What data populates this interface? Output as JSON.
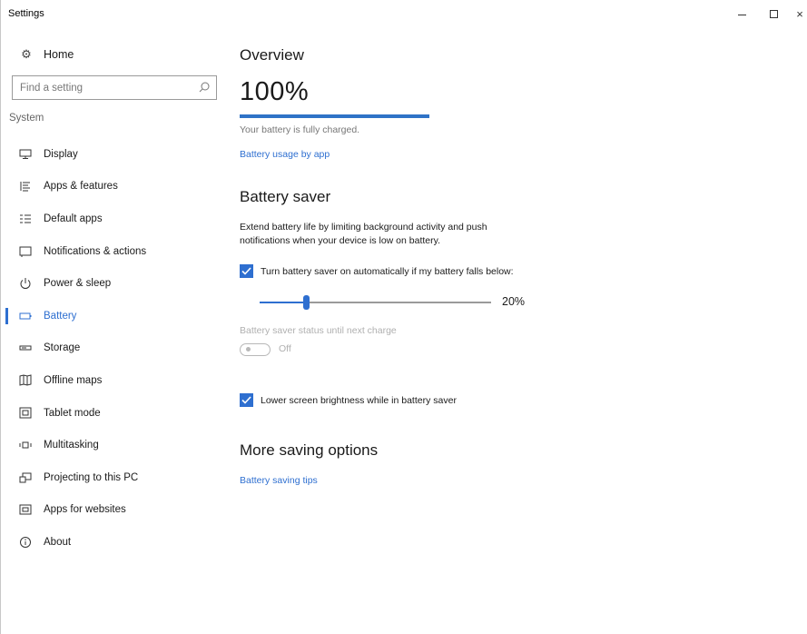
{
  "window": {
    "title": "Settings",
    "controls": {
      "minimize": "–",
      "maximize": "□",
      "close": "×"
    }
  },
  "sidebar": {
    "home_label": "Home",
    "home_icon": "gear-icon",
    "search_placeholder": "Find a setting",
    "section_label": "System",
    "items": [
      {
        "label": "Display",
        "icon": "monitor-icon",
        "active": false
      },
      {
        "label": "Apps & features",
        "icon": "list-icon",
        "active": false
      },
      {
        "label": "Default apps",
        "icon": "default-apps-icon",
        "active": false
      },
      {
        "label": "Notifications & actions",
        "icon": "notification-icon",
        "active": false
      },
      {
        "label": "Power & sleep",
        "icon": "power-icon",
        "active": false
      },
      {
        "label": "Battery",
        "icon": "battery-icon",
        "active": true
      },
      {
        "label": "Storage",
        "icon": "storage-icon",
        "active": false
      },
      {
        "label": "Offline maps",
        "icon": "map-icon",
        "active": false
      },
      {
        "label": "Tablet mode",
        "icon": "tablet-icon",
        "active": false
      },
      {
        "label": "Multitasking",
        "icon": "multitasking-icon",
        "active": false
      },
      {
        "label": "Projecting to this PC",
        "icon": "projecting-icon",
        "active": false
      },
      {
        "label": "Apps for websites",
        "icon": "web-apps-icon",
        "active": false
      },
      {
        "label": "About",
        "icon": "info-icon",
        "active": false
      }
    ]
  },
  "overview": {
    "heading": "Overview",
    "percent": "100%",
    "progress_fraction": 1.0,
    "status": "Your battery is fully charged.",
    "usage_link": "Battery usage by app"
  },
  "battery_saver": {
    "heading": "Battery saver",
    "description": "Extend battery life by limiting background activity and push notifications when your device is low on battery.",
    "auto_checkbox_label": "Turn battery saver on automatically if my battery falls below:",
    "auto_checked": true,
    "threshold_fraction": 0.2,
    "threshold_label": "20%",
    "status_label": "Battery saver status until next charge",
    "status_toggle": "Off",
    "brightness_checkbox_label": "Lower screen brightness while in battery saver",
    "brightness_checked": true
  },
  "more_saving": {
    "heading": "More saving options",
    "tips_link": "Battery saving tips"
  },
  "colors": {
    "accent": "#2e6fd0",
    "progress": "#2f73c7",
    "disabled": "#b0b0b0"
  }
}
